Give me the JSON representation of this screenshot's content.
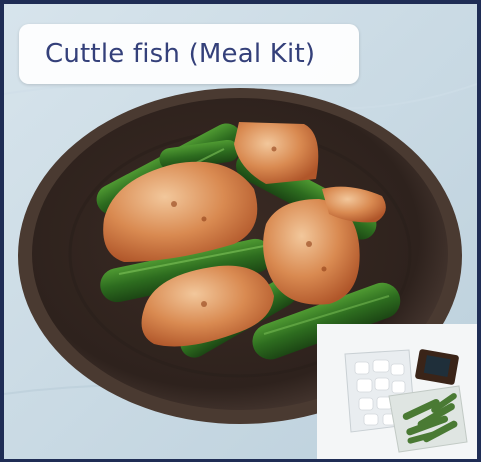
{
  "title": {
    "text": "Cuttle fish (Meal Kit)"
  },
  "colors": {
    "frame_border": "#1f2d55",
    "title_text": "#34407a",
    "background_cloth": "#c9dbe6",
    "plate": "#3a2a22",
    "sauce": "#c0672f",
    "okra": "#2f6a22"
  },
  "image": {
    "main_photo": "cuttlefish-okra-stir-fry-on-dark-plate",
    "inset_photo": "meal-kit-packages"
  }
}
